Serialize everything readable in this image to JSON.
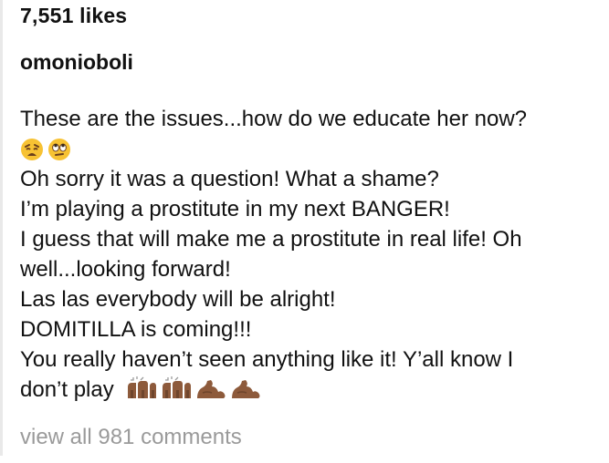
{
  "post": {
    "likes": "7,551 likes",
    "username": "omonioboli",
    "caption_lines": [
      "These are the issues...how do we educate her now?",
      "Oh sorry it was a question! What a shame?",
      "I’m playing a prostitute in my next BANGER!",
      "I guess that will make me a prostitute in real life! Oh",
      "well...looking forward!",
      "Las las everybody will be alright!",
      "DOMITILLA is coming!!!",
      "You really haven’t seen anything like it! Y’all know I",
      "don’t play"
    ],
    "view_all_comments": "view all 981 comments"
  },
  "icons": {
    "weary_face": "weary-face-emoji",
    "eye_roll_face": "face-with-rolling-eyes-emoji",
    "clap_hands": "clapping-hands-emoji",
    "flexed_bicep": "flexed-biceps-emoji"
  },
  "colors": {
    "text": "#111111",
    "muted_text": "#9a9a9a",
    "emoji_yellow": "#f7c233",
    "hand_brown": "#8d5a3b"
  }
}
